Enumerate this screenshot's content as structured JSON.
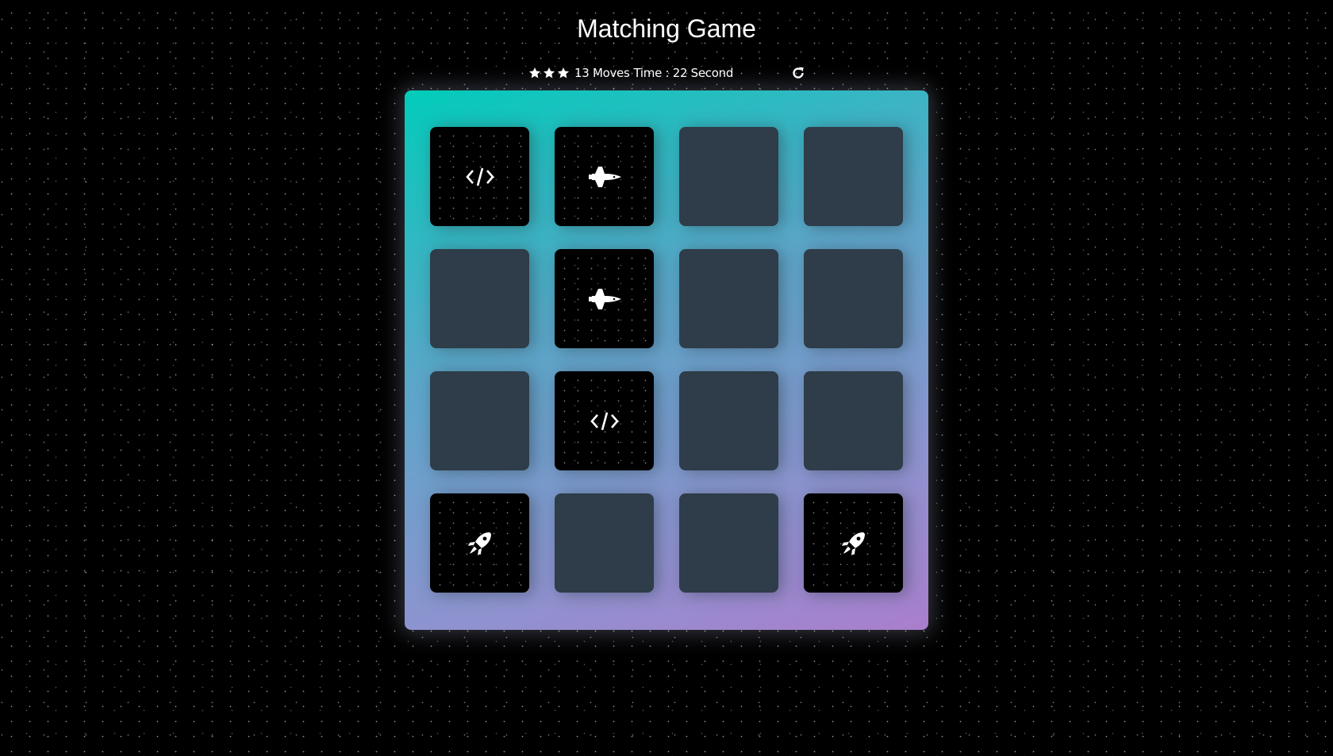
{
  "title": "Matching Game",
  "score_panel": {
    "stars": 3,
    "moves_text": "13 Moves",
    "time_text": "Time : 22 Second",
    "restart_icon": "restart-icon"
  },
  "deck": {
    "columns": 4,
    "rows": 4,
    "cards": [
      {
        "state": "open",
        "icon": "code-icon"
      },
      {
        "state": "open",
        "icon": "space-shuttle-icon"
      },
      {
        "state": "closed",
        "icon": ""
      },
      {
        "state": "closed",
        "icon": ""
      },
      {
        "state": "closed",
        "icon": ""
      },
      {
        "state": "open",
        "icon": "space-shuttle-icon"
      },
      {
        "state": "closed",
        "icon": ""
      },
      {
        "state": "closed",
        "icon": ""
      },
      {
        "state": "closed",
        "icon": ""
      },
      {
        "state": "open",
        "icon": "code-icon"
      },
      {
        "state": "closed",
        "icon": ""
      },
      {
        "state": "closed",
        "icon": ""
      },
      {
        "state": "open",
        "icon": "rocket-icon"
      },
      {
        "state": "closed",
        "icon": ""
      },
      {
        "state": "closed",
        "icon": ""
      },
      {
        "state": "open",
        "icon": "rocket-icon"
      }
    ]
  },
  "colors": {
    "background": "#000000",
    "deck_gradient_start": "#02ccba",
    "deck_gradient_end": "#aa7ecd",
    "card_closed": "#2e3d49",
    "card_open": "#000000",
    "text": "#ffffff"
  }
}
